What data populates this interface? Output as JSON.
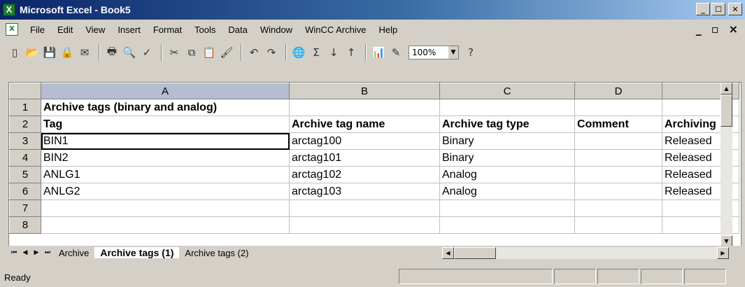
{
  "window": {
    "title": "Microsoft Excel - Book5"
  },
  "menu": [
    "File",
    "Edit",
    "View",
    "Insert",
    "Format",
    "Tools",
    "Data",
    "Window",
    "WinCC Archive",
    "Help"
  ],
  "toolbar": {
    "zoom": "100%"
  },
  "sheet": {
    "columns": [
      "A",
      "B",
      "C",
      "D"
    ],
    "rows": [
      {
        "num": "1",
        "cells": [
          "Archive tags (binary and analog)",
          "",
          "",
          "",
          ""
        ]
      },
      {
        "num": "2",
        "cells": [
          "Tag",
          "Archive tag name",
          "Archive tag type",
          "Comment",
          "Archiving"
        ]
      },
      {
        "num": "3",
        "cells": [
          "BIN1",
          "arctag100",
          "Binary",
          "",
          "Released"
        ]
      },
      {
        "num": "4",
        "cells": [
          "BIN2",
          "arctag101",
          "Binary",
          "",
          "Released"
        ]
      },
      {
        "num": "5",
        "cells": [
          "ANLG1",
          "arctag102",
          "Analog",
          "",
          "Released"
        ]
      },
      {
        "num": "6",
        "cells": [
          "ANLG2",
          "arctag103",
          "Analog",
          "",
          "Released"
        ]
      },
      {
        "num": "7",
        "cells": [
          "",
          "",
          "",
          "",
          ""
        ]
      },
      {
        "num": "8",
        "cells": [
          "",
          "",
          "",
          "",
          ""
        ]
      }
    ]
  },
  "tabs": [
    "Archive",
    "Archive tags (1)",
    "Archive tags (2)"
  ],
  "status": "Ready"
}
